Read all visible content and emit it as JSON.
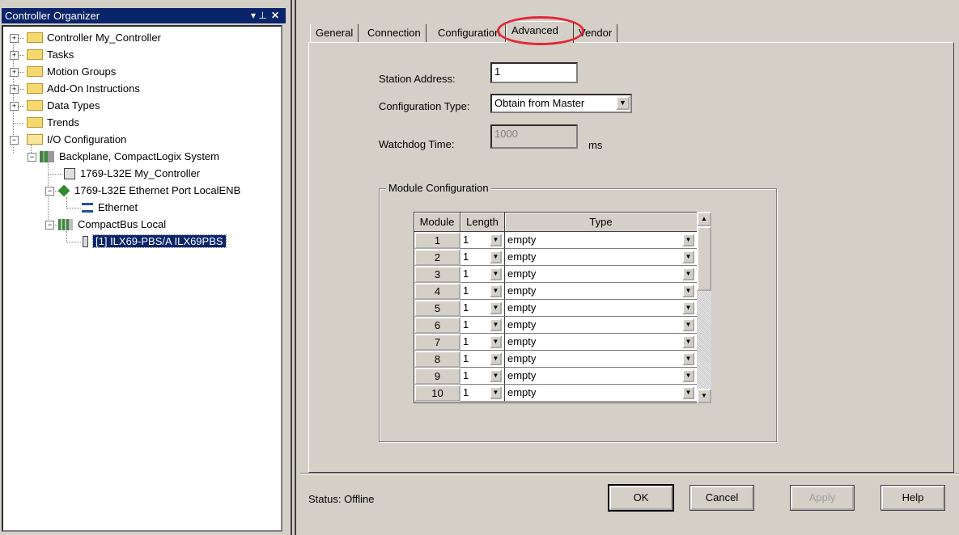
{
  "organizer": {
    "title": "Controller Organizer",
    "pin_glyph": "▾ ᵖ",
    "close_glyph": "✕",
    "tree": [
      {
        "label": "Controller My_Controller",
        "icon": "folder-icon",
        "expander": "+"
      },
      {
        "label": "Tasks",
        "icon": "folder-icon",
        "expander": "+"
      },
      {
        "label": "Motion Groups",
        "icon": "folder-icon",
        "expander": "+"
      },
      {
        "label": "Add-On Instructions",
        "icon": "folder-icon",
        "expander": "+"
      },
      {
        "label": "Data Types",
        "icon": "folder-icon",
        "expander": "+"
      },
      {
        "label": "Trends",
        "icon": "folder-icon",
        "expander": ""
      },
      {
        "label": "I/O Configuration",
        "icon": "open-folder-icon",
        "expander": "−"
      },
      {
        "label": "Backplane, CompactLogix System",
        "icon": "backplane-icon",
        "expander": "−"
      },
      {
        "label": "1769-L32E My_Controller",
        "icon": "controller-icon",
        "expander": ""
      },
      {
        "label": "1769-L32E Ethernet Port LocalENB",
        "icon": "ethernet-port-icon",
        "expander": "−"
      },
      {
        "label": "Ethernet",
        "icon": "network-icon",
        "expander": ""
      },
      {
        "label": "CompactBus Local",
        "icon": "bus-icon",
        "expander": "−"
      },
      {
        "label": "[1] ILX69-PBS/A ILX69PBS",
        "icon": "module-icon",
        "expander": ""
      }
    ]
  },
  "dialog": {
    "tabs": [
      "General",
      "Connection",
      "Configuration",
      "Advanced",
      "Vendor"
    ],
    "active_tab": "Advanced",
    "highlight_color": "#e32636",
    "station_address_label": "Station Address:",
    "station_address_value": "1",
    "config_type_label": "Configuration Type:",
    "config_type_value": "Obtain from Master",
    "watchdog_label": "Watchdog Time:",
    "watchdog_value": "1000",
    "watchdog_unit": "ms",
    "group_title": "Module Configuration",
    "grid": {
      "headers": [
        "Module",
        "Length",
        "Type"
      ],
      "rows": [
        {
          "module": "1",
          "length": "1",
          "type": "empty"
        },
        {
          "module": "2",
          "length": "1",
          "type": "empty"
        },
        {
          "module": "3",
          "length": "1",
          "type": "empty"
        },
        {
          "module": "4",
          "length": "1",
          "type": "empty"
        },
        {
          "module": "5",
          "length": "1",
          "type": "empty"
        },
        {
          "module": "6",
          "length": "1",
          "type": "empty"
        },
        {
          "module": "7",
          "length": "1",
          "type": "empty"
        },
        {
          "module": "8",
          "length": "1",
          "type": "empty"
        },
        {
          "module": "9",
          "length": "1",
          "type": "empty"
        },
        {
          "module": "10",
          "length": "1",
          "type": "empty"
        }
      ]
    },
    "status_label": "Status:",
    "status_value": "Offline",
    "buttons": {
      "ok": "OK",
      "cancel": "Cancel",
      "apply": "Apply",
      "help": "Help"
    }
  }
}
